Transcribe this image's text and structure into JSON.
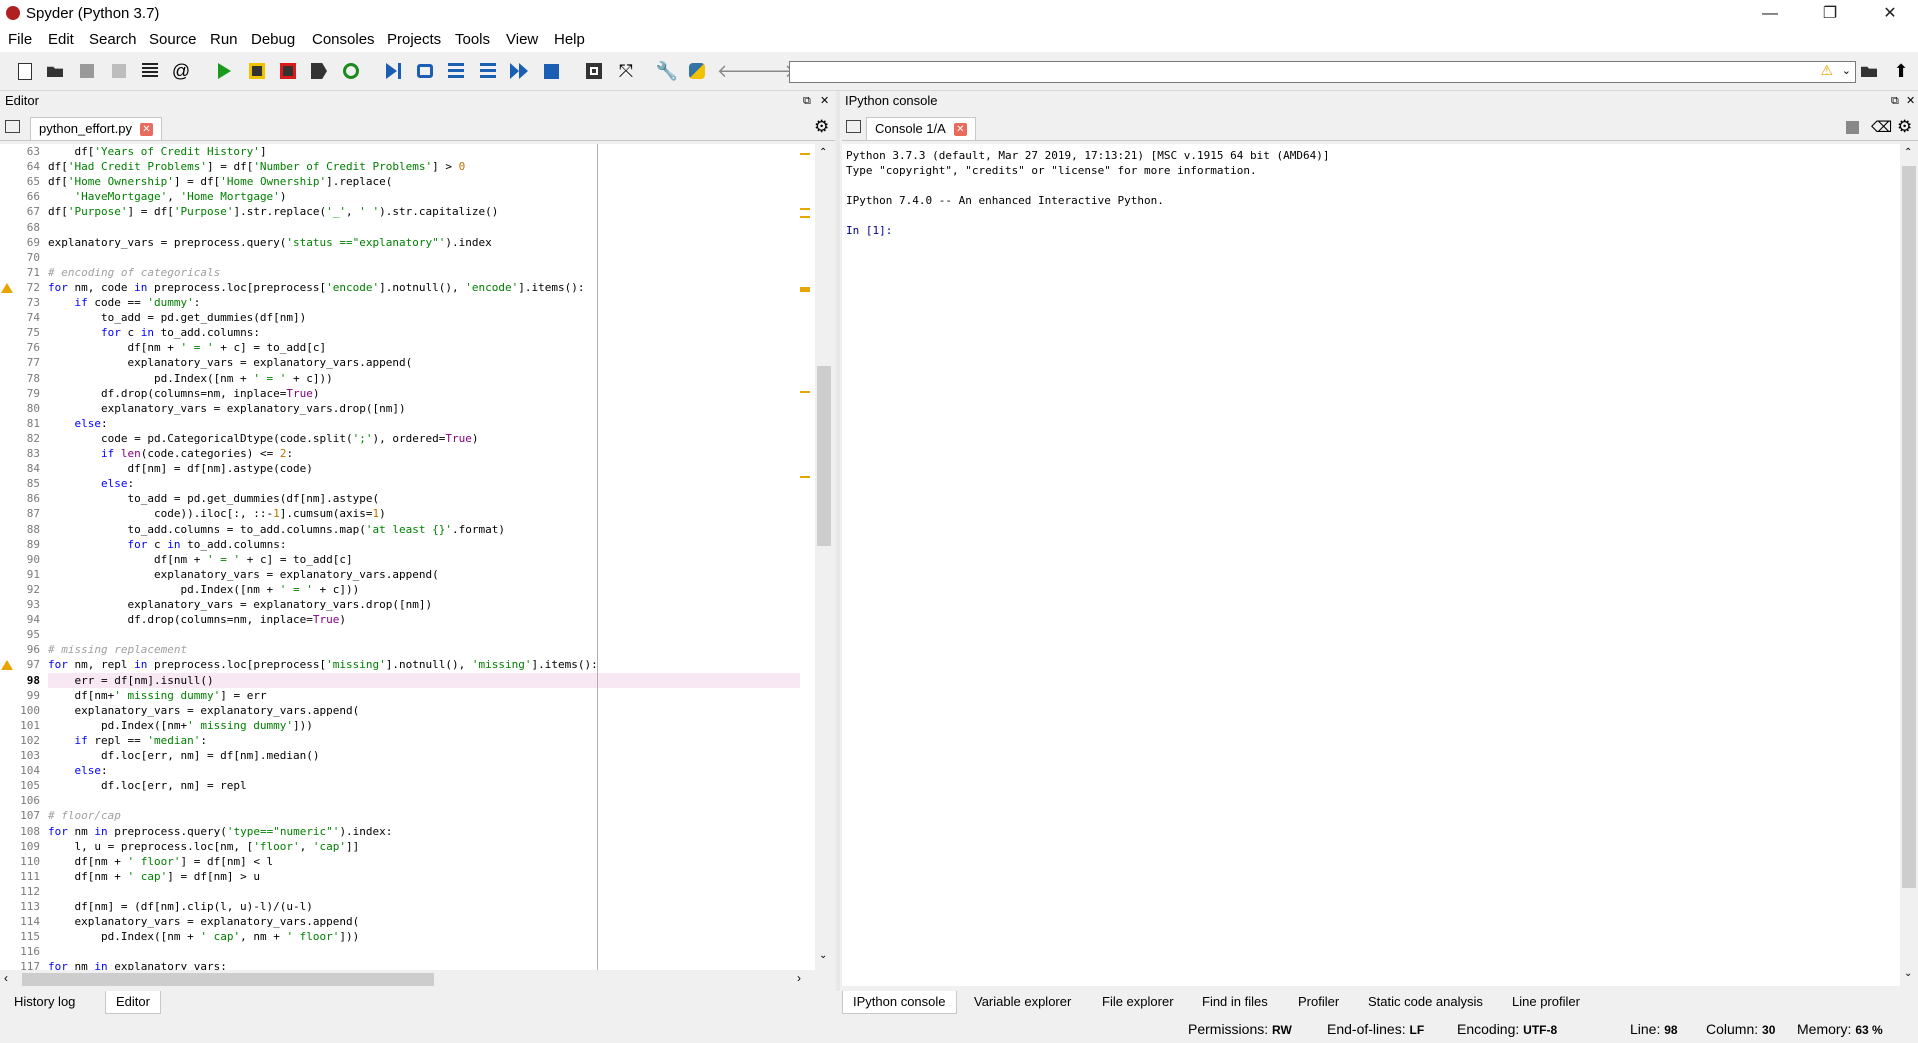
{
  "window": {
    "title": "Spyder (Python 3.7)",
    "minimize": "—",
    "restore": "❐",
    "close": "✕"
  },
  "menu": [
    "File",
    "Edit",
    "Search",
    "Source",
    "Run",
    "Debug",
    "Consoles",
    "Projects",
    "Tools",
    "View",
    "Help"
  ],
  "toolbar": {
    "icons": [
      "new-file-icon",
      "open-file-icon",
      "save-icon",
      "save-all-icon",
      "outline-icon",
      "at-icon",
      "run-icon",
      "run-cell-icon",
      "run-cell-advance-icon",
      "run-selection-icon",
      "rerun-icon",
      "debug-icon",
      "step-icon",
      "step-into-icon",
      "step-return-icon",
      "continue-icon",
      "stop-icon",
      "maximize-pane-icon",
      "fullscreen-icon",
      "preferences-icon",
      "python-path-icon",
      "back-icon",
      "forward-icon"
    ],
    "path_value": "",
    "warning_glyph": "⚠",
    "browse_glyph": "📂",
    "up_glyph": "⬆"
  },
  "editor": {
    "pane_title": "Editor",
    "file_tab": "python_effort.py",
    "current_line": 98
  },
  "console": {
    "pane_title": "IPython console",
    "tab": "Console 1/A",
    "lines": [
      "Python 3.7.3 (default, Mar 27 2019, 17:13:21) [MSC v.1915 64 bit (AMD64)]",
      "Type \"copyright\", \"credits\" or \"license\" for more information.",
      "",
      "IPython 7.4.0 -- An enhanced Interactive Python.",
      "",
      "In [1]:"
    ]
  },
  "left_bottom_tabs": [
    "History log",
    "Editor"
  ],
  "right_bottom_tabs": [
    "IPython console",
    "Variable explorer",
    "File explorer",
    "Find in files",
    "Profiler",
    "Static code analysis",
    "Line profiler"
  ],
  "status": {
    "permissions_label": "Permissions:",
    "permissions_value": "RW",
    "eol_label": "End-of-lines:",
    "eol_value": "LF",
    "encoding_label": "Encoding:",
    "encoding_value": "UTF-8",
    "line_label": "Line:",
    "line_value": "98",
    "column_label": "Column:",
    "column_value": "30",
    "memory_label": "Memory:",
    "memory_value": "63 %"
  },
  "code_lines": [
    {
      "n": "63",
      "t": "    df['Years of Credit History']"
    },
    {
      "n": "64",
      "t": "df['Had Credit Problems'] = df['Number of Credit Problems'] > 0"
    },
    {
      "n": "65",
      "t": "df['Home Ownership'] = df['Home Ownership'].replace("
    },
    {
      "n": "66",
      "t": "    'HaveMortgage', 'Home Mortgage')"
    },
    {
      "n": "67",
      "t": "df['Purpose'] = df['Purpose'].str.replace('_', ' ').str.capitalize()"
    },
    {
      "n": "68",
      "t": ""
    },
    {
      "n": "69",
      "t": "explanatory_vars = preprocess.query('status ==\"explanatory\"').index"
    },
    {
      "n": "70",
      "t": ""
    },
    {
      "n": "71",
      "t": "# encoding of categoricals"
    },
    {
      "n": "72",
      "t": "for nm, code in preprocess.loc[preprocess['encode'].notnull(), 'encode'].items():"
    },
    {
      "n": "73",
      "t": "    if code == 'dummy':"
    },
    {
      "n": "74",
      "t": "        to_add = pd.get_dummies(df[nm])"
    },
    {
      "n": "75",
      "t": "        for c in to_add.columns:"
    },
    {
      "n": "76",
      "t": "            df[nm + ' = ' + c] = to_add[c]"
    },
    {
      "n": "77",
      "t": "            explanatory_vars = explanatory_vars.append("
    },
    {
      "n": "78",
      "t": "                pd.Index([nm + ' = ' + c]))"
    },
    {
      "n": "79",
      "t": "        df.drop(columns=nm, inplace=True)"
    },
    {
      "n": "80",
      "t": "        explanatory_vars = explanatory_vars.drop([nm])"
    },
    {
      "n": "81",
      "t": "    else:"
    },
    {
      "n": "82",
      "t": "        code = pd.CategoricalDtype(code.split(';'), ordered=True)"
    },
    {
      "n": "83",
      "t": "        if len(code.categories) <= 2:"
    },
    {
      "n": "84",
      "t": "            df[nm] = df[nm].astype(code)"
    },
    {
      "n": "85",
      "t": "        else:"
    },
    {
      "n": "86",
      "t": "            to_add = pd.get_dummies(df[nm].astype("
    },
    {
      "n": "87",
      "t": "                code)).iloc[:, ::-1].cumsum(axis=1)"
    },
    {
      "n": "88",
      "t": "            to_add.columns = to_add.columns.map('at least {}'.format)"
    },
    {
      "n": "89",
      "t": "            for c in to_add.columns:"
    },
    {
      "n": "90",
      "t": "                df[nm + ' = ' + c] = to_add[c]"
    },
    {
      "n": "91",
      "t": "                explanatory_vars = explanatory_vars.append("
    },
    {
      "n": "92",
      "t": "                    pd.Index([nm + ' = ' + c]))"
    },
    {
      "n": "93",
      "t": "            explanatory_vars = explanatory_vars.drop([nm])"
    },
    {
      "n": "94",
      "t": "            df.drop(columns=nm, inplace=True)"
    },
    {
      "n": "95",
      "t": ""
    },
    {
      "n": "96",
      "t": "# missing replacement"
    },
    {
      "n": "97",
      "t": "for nm, repl in preprocess.loc[preprocess['missing'].notnull(), 'missing'].items():"
    },
    {
      "n": "98",
      "t": "    err = df[nm].isnull()"
    },
    {
      "n": "99",
      "t": "    df[nm+' missing dummy'] = err"
    },
    {
      "n": "100",
      "t": "    explanatory_vars = explanatory_vars.append("
    },
    {
      "n": "101",
      "t": "        pd.Index([nm+' missing dummy']))"
    },
    {
      "n": "102",
      "t": "    if repl == 'median':"
    },
    {
      "n": "103",
      "t": "        df.loc[err, nm] = df[nm].median()"
    },
    {
      "n": "104",
      "t": "    else:"
    },
    {
      "n": "105",
      "t": "        df.loc[err, nm] = repl"
    },
    {
      "n": "106",
      "t": ""
    },
    {
      "n": "107",
      "t": "# floor/cap"
    },
    {
      "n": "108",
      "t": "for nm in preprocess.query('type==\"numeric\"').index:"
    },
    {
      "n": "109",
      "t": "    l, u = preprocess.loc[nm, ['floor', 'cap']]"
    },
    {
      "n": "110",
      "t": "    df[nm + ' floor'] = df[nm] < l"
    },
    {
      "n": "111",
      "t": "    df[nm + ' cap'] = df[nm] > u"
    },
    {
      "n": "112",
      "t": ""
    },
    {
      "n": "113",
      "t": "    df[nm] = (df[nm].clip(l, u)-l)/(u-l)"
    },
    {
      "n": "114",
      "t": "    explanatory_vars = explanatory_vars.append("
    },
    {
      "n": "115",
      "t": "        pd.Index([nm + ' cap', nm + ' floor']))"
    },
    {
      "n": "116",
      "t": ""
    },
    {
      "n": "117",
      "t": "for nm in explanatory_vars:"
    }
  ],
  "warning_lines": [
    "72",
    "97"
  ]
}
